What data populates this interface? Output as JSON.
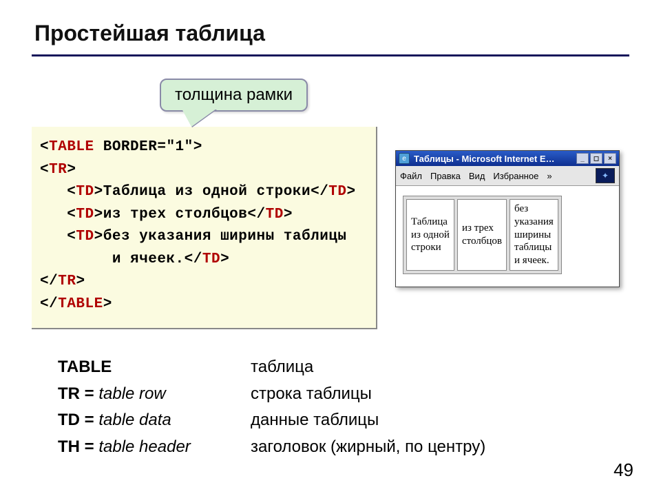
{
  "title": "Простейшая таблица",
  "callout": "толщина рамки",
  "code": {
    "l1a": "<",
    "l1b": "TABLE",
    "l1c": " BORDER=\"1\">",
    "l2a": "<",
    "l2b": "TR",
    "l2c": ">",
    "l3a": "   <",
    "l3b": "TD",
    "l3c": ">Таблица из одной строки</",
    "l3d": "TD",
    "l3e": ">",
    "l4a": "   <",
    "l4b": "TD",
    "l4c": ">из трех столбцов</",
    "l4d": "TD",
    "l4e": ">",
    "l5a": "   <",
    "l5b": "TD",
    "l5c": ">без указания ширины таблицы",
    "l6": "        и ячеек.</",
    "l6b": "TD",
    "l6c": ">",
    "l7a": "</",
    "l7b": "TR",
    "l7c": ">",
    "l8a": "</",
    "l8b": "TABLE",
    "l8c": ">"
  },
  "browser": {
    "title": "Таблицы - Microsoft Internet E…",
    "menu": {
      "file": "Файл",
      "edit": "Правка",
      "view": "Вид",
      "fav": "Избранное",
      "more": "»"
    },
    "cells": {
      "c1": "Таблица\nиз одной\nстроки",
      "c2": "из трех\nстолбцов",
      "c3": "без\nуказания\nширины\nтаблицы\nи ячеек."
    }
  },
  "defs": {
    "r1l": "TABLE",
    "r1r": "таблица",
    "r2la": "TR = ",
    "r2lb": "table row",
    "r2r": "строка таблицы",
    "r3la": "TD = ",
    "r3lb": "table data",
    "r3r": "данные таблицы",
    "r4la": "TH = ",
    "r4lb": "table header",
    "r4r": "заголовок (жирный, по центру)"
  },
  "page": "49"
}
